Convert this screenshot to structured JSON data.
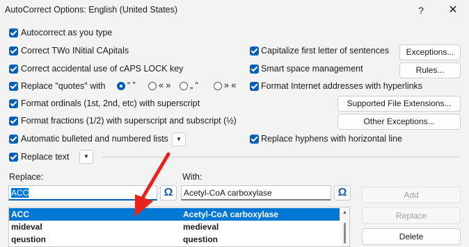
{
  "window": {
    "title": "AutoCorrect Options: English (United States)",
    "help_glyph": "?",
    "close_glyph": "✕"
  },
  "options_left": [
    "Autocorrect as you type",
    "Correct TWo INitial CApitals",
    "Correct accidental use of cAPS LOCK key",
    "Replace \"quotes\" with",
    "Format ordinals (1st, 2nd, etc) with superscript",
    "Format fractions (1/2) with superscript and subscript (½)",
    "Automatic bulleted and numbered lists",
    "Replace text"
  ],
  "quote_styles": [
    "“ ”",
    "« »",
    "„ “",
    "» «"
  ],
  "options_right": [
    "Capitalize first letter of sentences",
    "Smart space management",
    "Format Internet addresses with hyperlinks",
    "Replace hyphens with horizontal line"
  ],
  "buttons": {
    "exceptions": "Exceptions...",
    "rules": "Rules...",
    "supported_ext": "Supported File Extensions...",
    "other_exceptions": "Other Exceptions...",
    "add": "Add",
    "replace": "Replace",
    "delete": "Delete"
  },
  "replace_section": {
    "replace_label": "Replace:",
    "with_label": "With:",
    "replace_value": "ACC",
    "with_value": "Acetyl-CoA carboxylase",
    "omega": "Ω"
  },
  "entries": [
    {
      "replace": "ACC",
      "with": "Acetyl-CoA carboxylase",
      "selected": true
    },
    {
      "replace": "mideval",
      "with": "medieval",
      "selected": false
    },
    {
      "replace": "qeustion",
      "with": "question",
      "selected": false
    }
  ],
  "colors": {
    "accent": "#005fb8",
    "selection": "#0078d4",
    "annotation_arrow": "#e8231c"
  }
}
